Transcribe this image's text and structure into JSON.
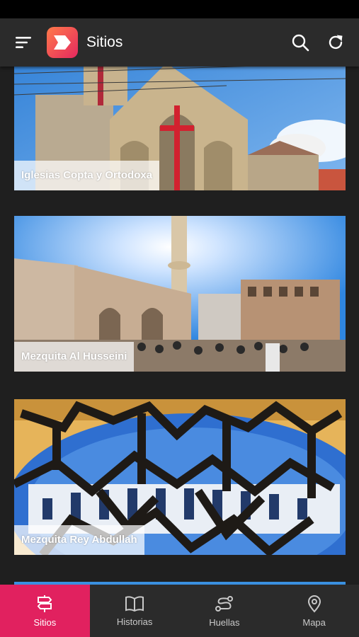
{
  "header": {
    "title": "Sitios",
    "menu_icon": "menu-icon",
    "search_icon": "search-icon",
    "refresh_icon": "refresh-icon"
  },
  "sites": [
    {
      "label": "Iglesias Copta y Ortodoxa"
    },
    {
      "label": "Mezquita Al Husseini"
    },
    {
      "label": "Mezquita Rey Abdullah"
    }
  ],
  "nav": [
    {
      "label": "Sitios",
      "icon": "signpost-icon",
      "active": true
    },
    {
      "label": "Historias",
      "icon": "book-icon",
      "active": false
    },
    {
      "label": "Huellas",
      "icon": "route-icon",
      "active": false
    },
    {
      "label": "Mapa",
      "icon": "map-pin-icon",
      "active": false
    }
  ],
  "colors": {
    "accent": "#e1215f",
    "bar": "#2b2b2b",
    "background": "#1f1f1f"
  }
}
